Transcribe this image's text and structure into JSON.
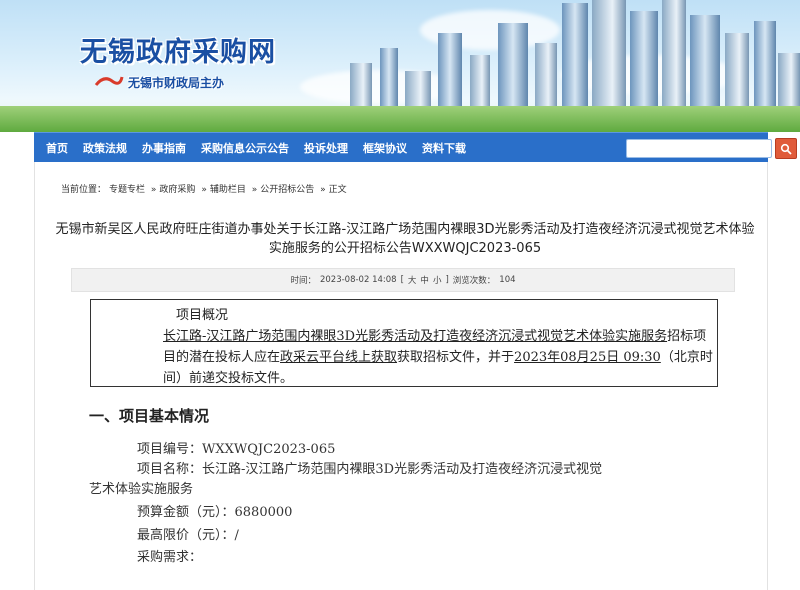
{
  "header": {
    "site_title": "无锡政府采购网",
    "site_subtitle": "无锡市财政局主办"
  },
  "nav": {
    "items": [
      "首页",
      "政策法规",
      "办事指南",
      "采购信息公示公告",
      "投诉处理",
      "框架协议",
      "资料下载"
    ],
    "search_value": ""
  },
  "breadcrumb": {
    "prefix": "当前位置：",
    "items": [
      "专题专栏",
      "政府采购",
      "辅助栏目",
      "公开招标公告",
      "正文"
    ],
    "separator": "»"
  },
  "article": {
    "title": "无锡市新吴区人民政府旺庄街道办事处关于长江路-汉江路广场范围内裸眼3D光影秀活动及打造夜经济沉浸式视觉艺术体验实施服务的公开招标公告WXXWQJC2023-065",
    "meta": {
      "time_label": "时间：",
      "time_value": "2023-08-02 14:08",
      "font_bracket_open": "[",
      "font_large": "大",
      "font_medium": "中",
      "font_small": "小",
      "font_bracket_close": "]",
      "views_label": "浏览次数：",
      "views_value": "104"
    },
    "overview": {
      "title": "项目概况",
      "project_link": "长江路-汉江路广场范围内裸眼3D光影秀活动及打造夜经济沉浸式视觉艺术体验实施服务",
      "text1": "招标项目的潜在投标人应在",
      "platform_link": "政采云平台线上获取",
      "text2": "获取招标文件，并于",
      "deadline_link": "2023年08月25日 09:30",
      "text3": "（北京时间）前递交投标文件。"
    },
    "section1_heading": "一、项目基本情况",
    "details": {
      "code_label": "项目编号：",
      "code_value": "WXXWQJC2023-065",
      "name_label": "项目名称：",
      "name_value_line1": "长江路-汉江路广场范围内裸眼3D光影秀活动及打造夜经济沉浸式视觉",
      "name_value_line2": "艺术体验实施服务",
      "budget_label": "预算金额（元）：",
      "budget_value": "6880000",
      "max_price_label": "最高限价（元）：",
      "max_price_value": "/",
      "requirement_label": "采购需求："
    }
  },
  "colors": {
    "nav_bg": "#2a6fc9",
    "title_blue": "#1a4fa3",
    "search_btn": "#e05b3a"
  }
}
